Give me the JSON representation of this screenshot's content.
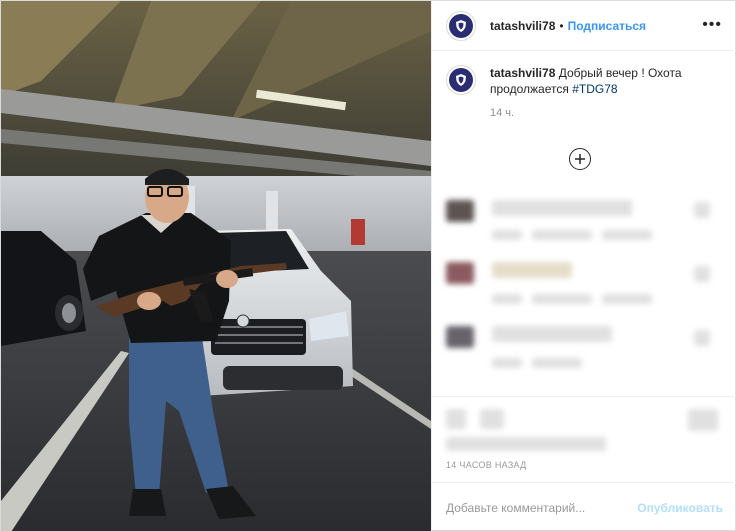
{
  "header": {
    "username": "tatashvili78",
    "separator": "•",
    "follow_label": "Подписаться",
    "more_icon": "more-options-icon"
  },
  "caption": {
    "username": "tatashvili78",
    "text": "Добрый вечер ! Охота продолжается",
    "hashtag": "#TDG78",
    "time": "14 ч."
  },
  "load_more_icon": "plus-circle-icon",
  "footer": {
    "posted_ago": "14 ЧАСОВ НАЗАД",
    "comment_placeholder": "Добавьте комментарий...",
    "publish_label": "Опубликовать"
  },
  "colors": {
    "link": "#3897f0",
    "hashtag": "#003569",
    "publish_disabled": "#b2dffc",
    "avatar_badge": "#2b2d73"
  }
}
